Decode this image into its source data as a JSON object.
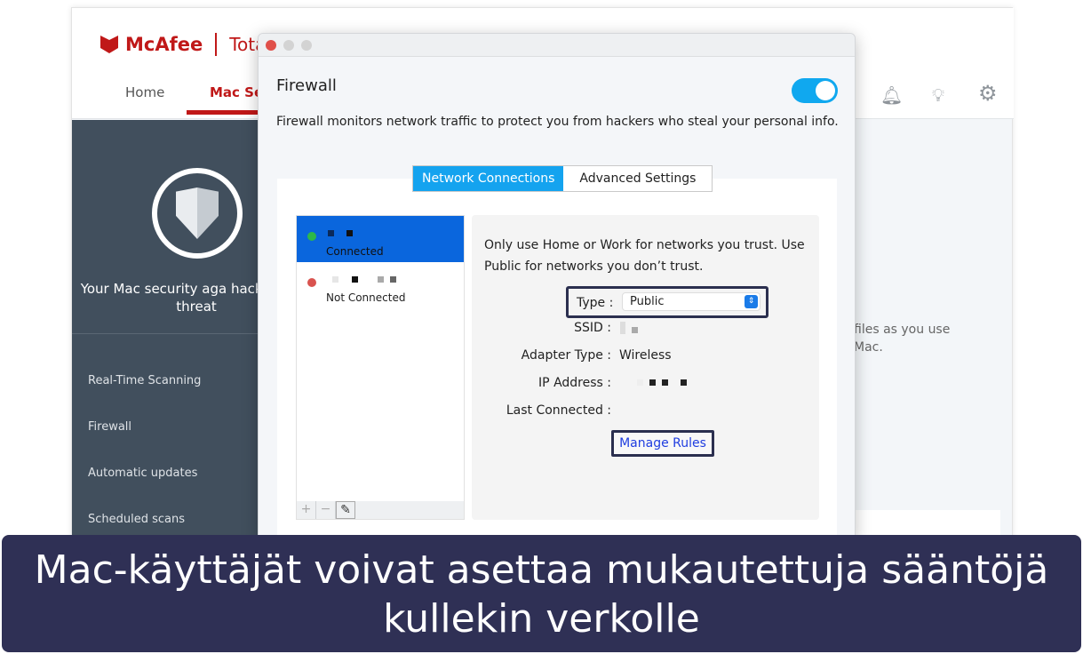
{
  "app": {
    "brand": "McAfee",
    "product": "Total",
    "nav": [
      "Home",
      "Mac Sec"
    ],
    "sidebar_text": "Your Mac security aga hackers and threat",
    "sidebar_items": [
      "Real-Time Scanning",
      "Firewall",
      "Automatic updates",
      "Scheduled scans"
    ],
    "background_text": "files as you use Mac.",
    "icons": [
      "bell-icon",
      "lightbulb-icon",
      "gear-icon"
    ]
  },
  "dialog": {
    "title": "Firewall",
    "toggle_on": true,
    "description": "Firewall monitors network traffic to protect you from hackers who steal your personal info.",
    "tabs": [
      "Network Connections",
      "Advanced Settings"
    ],
    "active_tab": "Network Connections",
    "networks": [
      {
        "status": "Connected",
        "color": "#2db84a"
      },
      {
        "status": "Not Connected",
        "color": "#d9534f"
      }
    ],
    "list_buttons": [
      "+",
      "−",
      "✎"
    ],
    "info": "Only use Home or Work for networks you trust. Use Public for networks you don’t trust.",
    "fields": {
      "type_label": "Type :",
      "type_value": "Public",
      "ssid_label": "SSID :",
      "adapter_label": "Adapter Type :",
      "adapter_value": "Wireless",
      "ip_label": "IP Address :",
      "last_label": "Last Connected :"
    },
    "manage_rules": "Manage Rules"
  },
  "caption": "Mac-käyttäjät voivat asettaa mukautettuja sääntöjä kullekin verkolle",
  "colors": {
    "brand": "#c01818",
    "toggle": "#10a8ef",
    "selection": "#0a66dd",
    "caption_bg": "#2f3055"
  }
}
